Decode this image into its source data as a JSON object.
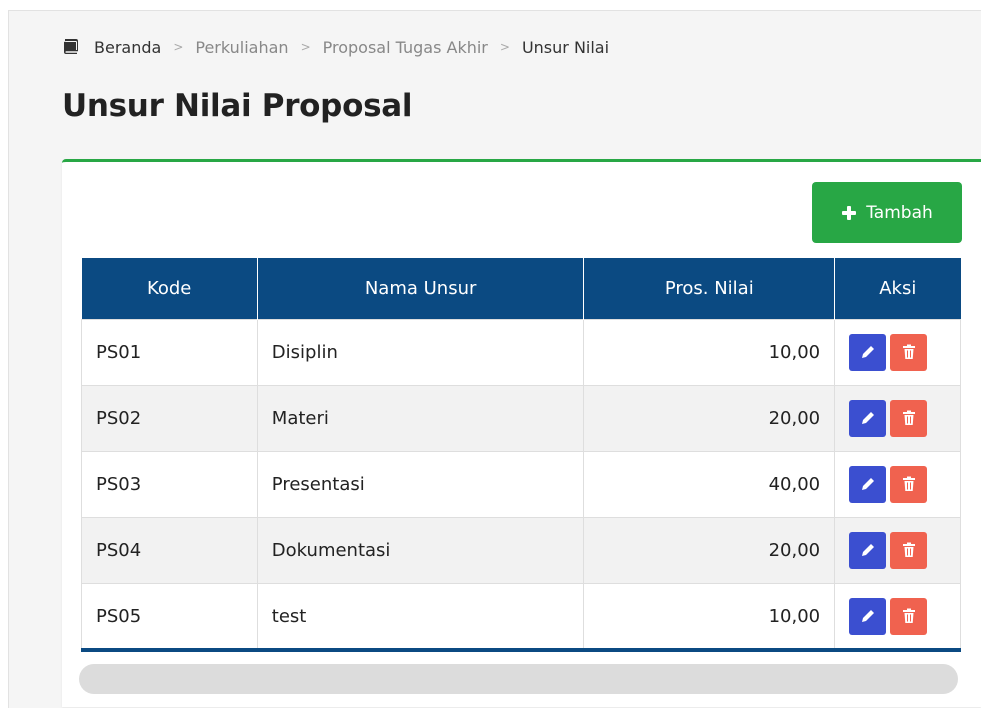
{
  "breadcrumb": {
    "icon": "book-icon",
    "items": [
      "Beranda",
      "Perkuliahan",
      "Proposal Tugas Akhir",
      "Unsur Nilai"
    ]
  },
  "page": {
    "title": "Unsur Nilai Proposal"
  },
  "actions": {
    "add_label": "Tambah",
    "add_icon": "plus-icon"
  },
  "table": {
    "columns": [
      "Kode",
      "Nama Unsur",
      "Pros. Nilai",
      "Aksi"
    ],
    "rows": [
      {
        "kode": "PS01",
        "nama": "Disiplin",
        "nilai": "10,00"
      },
      {
        "kode": "PS02",
        "nama": "Materi",
        "nilai": "20,00"
      },
      {
        "kode": "PS03",
        "nama": "Presentasi",
        "nilai": "40,00"
      },
      {
        "kode": "PS04",
        "nama": "Dokumentasi",
        "nilai": "20,00"
      },
      {
        "kode": "PS05",
        "nama": "test",
        "nilai": "10,00"
      }
    ],
    "row_actions": {
      "edit_icon": "pencil-icon",
      "delete_icon": "trash-icon"
    }
  },
  "colors": {
    "header": "#0b4a82",
    "add_button": "#28a745",
    "card_border": "#28a745",
    "edit_button": "#3b4fd0",
    "delete_button": "#f0624f"
  }
}
